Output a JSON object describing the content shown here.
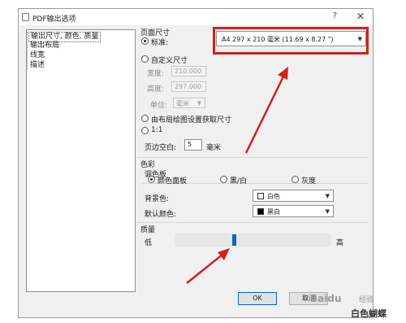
{
  "dialog": {
    "title": "PDF输出选项",
    "help": "?",
    "close": "✕",
    "nav": [
      "输出尺寸, 颜色, 质量",
      "输出布局",
      "线宽",
      "描述"
    ]
  },
  "page_size": {
    "heading": "页面尺寸",
    "standard_label": "标准:",
    "standard_value": "A4 297 x 210 毫米 (11.69 x 8.27 \")",
    "custom_label": "自定义尺寸",
    "width_label": "宽度:",
    "width_value": "210.000",
    "height_label": "高度:",
    "height_value": "297.000",
    "unit_label": "单位:",
    "unit_value": "毫米",
    "from_layout_label": "由布局绘图设置获取尺寸",
    "one_to_one_label": "1:1",
    "margin_label": "页边空白:",
    "margin_value": "5",
    "margin_unit": "毫米"
  },
  "color": {
    "heading": "色彩",
    "palette_heading": "调色板",
    "palette_options": [
      "颜色面板",
      "黑/白",
      "灰度"
    ],
    "background_label": "背景色:",
    "background_value": "白色",
    "default_color_label": "默认颜色:",
    "default_color_value": "黑白",
    "background_swatch": "#ffffff",
    "default_swatch": "#000000"
  },
  "quality": {
    "heading": "质量",
    "low_label": "低",
    "high_label": "高",
    "level": 0.38
  },
  "buttons": {
    "ok": "OK",
    "cancel": "取消"
  },
  "watermark": {
    "baidu": "Baidu",
    "account": "白色蝴蝶",
    "site": "经验"
  },
  "colors": {
    "highlight": "#d0211d",
    "slider_thumb": "#1565c0"
  }
}
